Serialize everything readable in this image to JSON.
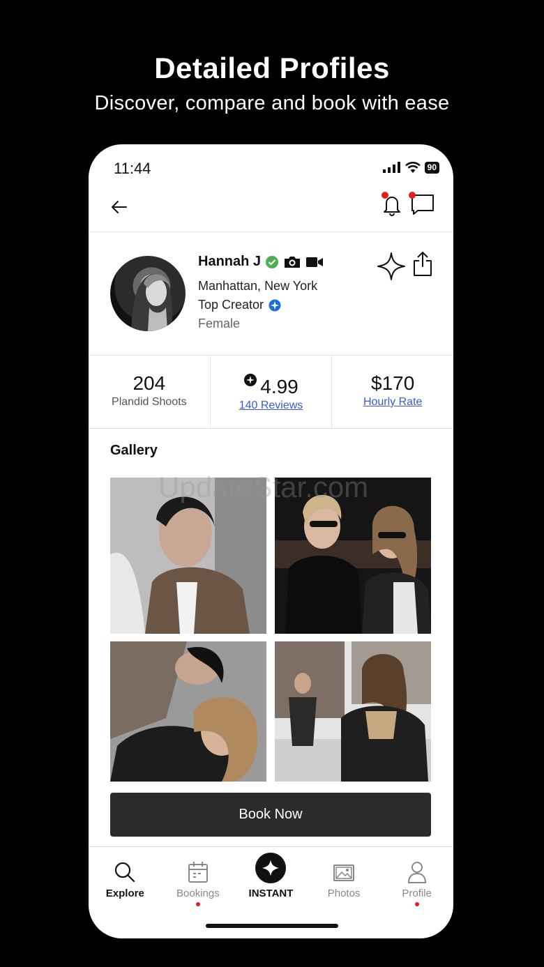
{
  "hero": {
    "title": "Detailed Profiles",
    "subtitle": "Discover, compare and book with ease"
  },
  "status_bar": {
    "time": "11:44",
    "battery": "90"
  },
  "profile": {
    "name": "Hannah J",
    "location": "Manhattan, New York",
    "badge": "Top Creator",
    "gender": "Female"
  },
  "stats": {
    "shoots_value": "204",
    "shoots_label": "Plandid Shoots",
    "rating_value": "4.99",
    "rating_label": "140 Reviews",
    "rate_value": "$170",
    "rate_label": "Hourly Rate"
  },
  "gallery": {
    "title": "Gallery",
    "watermark": "UpdateStar.com"
  },
  "book_button": "Book Now",
  "nav": {
    "items": [
      {
        "label": "Explore",
        "icon": "search-icon"
      },
      {
        "label": "Bookings",
        "icon": "calendar-icon"
      },
      {
        "label": "INSTANT",
        "icon": "sparkle-icon"
      },
      {
        "label": "Photos",
        "icon": "photos-icon"
      },
      {
        "label": "Profile",
        "icon": "person-icon"
      }
    ]
  },
  "colors": {
    "background": "#000000",
    "accent_red": "#e02020",
    "verified_green": "#4caf50",
    "creator_blue": "#1e6fd9",
    "link_blue": "#3a5bd9",
    "button_dark": "#2b2b2b"
  }
}
